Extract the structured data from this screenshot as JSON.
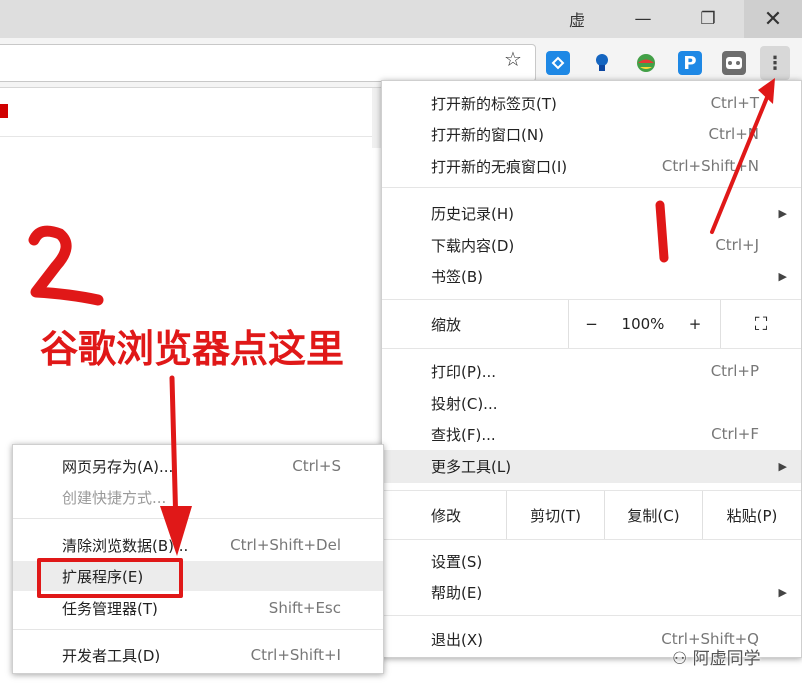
{
  "titlebar": {
    "profile_glyph": "虚",
    "min_glyph": "—",
    "max_glyph": "❐",
    "close_glyph": "✕"
  },
  "toolbar": {
    "star_glyph": "☆",
    "ext4_glyph": "P",
    "menu_glyph": "⋮"
  },
  "menu": {
    "items": [
      {
        "label": "打开新的标签页(T)",
        "shortcut": "Ctrl+T"
      },
      {
        "label": "打开新的窗口(N)",
        "shortcut": "Ctrl+N"
      },
      {
        "label": "打开新的无痕窗口(I)",
        "shortcut": "Ctrl+Shift+N"
      },
      {
        "label": "历史记录(H)",
        "arrow": "▶"
      },
      {
        "label": "下载内容(D)",
        "shortcut": "Ctrl+J"
      },
      {
        "label": "书签(B)",
        "arrow": "▶"
      },
      {
        "label": "打印(P)...",
        "shortcut": "Ctrl+P"
      },
      {
        "label": "投射(C)..."
      },
      {
        "label": "查找(F)...",
        "shortcut": "Ctrl+F"
      },
      {
        "label": "更多工具(L)",
        "arrow": "▶"
      },
      {
        "label": "设置(S)"
      },
      {
        "label": "帮助(E)",
        "arrow": "▶"
      },
      {
        "label": "退出(X)",
        "shortcut": "Ctrl+Shift+Q"
      }
    ],
    "zoom": {
      "label": "缩放",
      "minus": "−",
      "value": "100%",
      "plus": "+",
      "fullscreen": "⛶"
    },
    "edit": {
      "label": "修改",
      "cut": "剪切(T)",
      "copy": "复制(C)",
      "paste": "粘贴(P)"
    }
  },
  "submenu": {
    "items": [
      {
        "label": "网页另存为(A)...",
        "shortcut": "Ctrl+S"
      },
      {
        "label": "创建快捷方式..."
      },
      {
        "label": "清除浏览数据(B)...",
        "shortcut": "Ctrl+Shift+Del"
      },
      {
        "label": "扩展程序(E)"
      },
      {
        "label": "任务管理器(T)",
        "shortcut": "Shift+Esc"
      },
      {
        "label": "开发者工具(D)",
        "shortcut": "Ctrl+Shift+I"
      }
    ]
  },
  "annotations": {
    "text": "谷歌浏览器点这里",
    "color": "#e01818"
  },
  "watermark": "阿虚同学"
}
